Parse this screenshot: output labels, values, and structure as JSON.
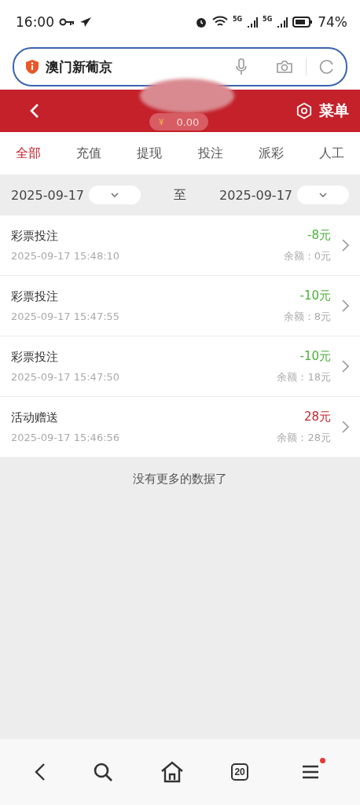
{
  "status_bar": {
    "time": "16:00",
    "battery": "74%",
    "network_1": "5G",
    "network_2": "5G"
  },
  "address_bar": {
    "value": "澳门新葡京"
  },
  "header": {
    "balance_symbol": "¥",
    "balance": "0.00",
    "menu_label": "菜单"
  },
  "tabs": [
    {
      "label": "全部",
      "selected": true
    },
    {
      "label": "充值",
      "selected": false
    },
    {
      "label": "提现",
      "selected": false
    },
    {
      "label": "投注",
      "selected": false
    },
    {
      "label": "派彩",
      "selected": false
    },
    {
      "label": "人工",
      "selected": false
    }
  ],
  "date_filter": {
    "start": "2025-09-17",
    "separator": "至",
    "end": "2025-09-17"
  },
  "records": [
    {
      "title": "彩票投注",
      "time": "2025-09-17 15:48:10",
      "amount": "-8元",
      "color": "#4caf3a",
      "balance": "余额：0元"
    },
    {
      "title": "彩票投注",
      "time": "2025-09-17 15:47:55",
      "amount": "-10元",
      "color": "#4caf3a",
      "balance": "余额：8元"
    },
    {
      "title": "彩票投注",
      "time": "2025-09-17 15:47:50",
      "amount": "-10元",
      "color": "#4caf3a",
      "balance": "余额：18元"
    },
    {
      "title": "活动赠送",
      "time": "2025-09-17 15:46:56",
      "amount": "28元",
      "color": "#c0282e",
      "balance": "余额：28元"
    }
  ],
  "end_message": "没有更多的数据了",
  "bottom_nav": {
    "tab_count": "20",
    "menu_badge": true
  }
}
